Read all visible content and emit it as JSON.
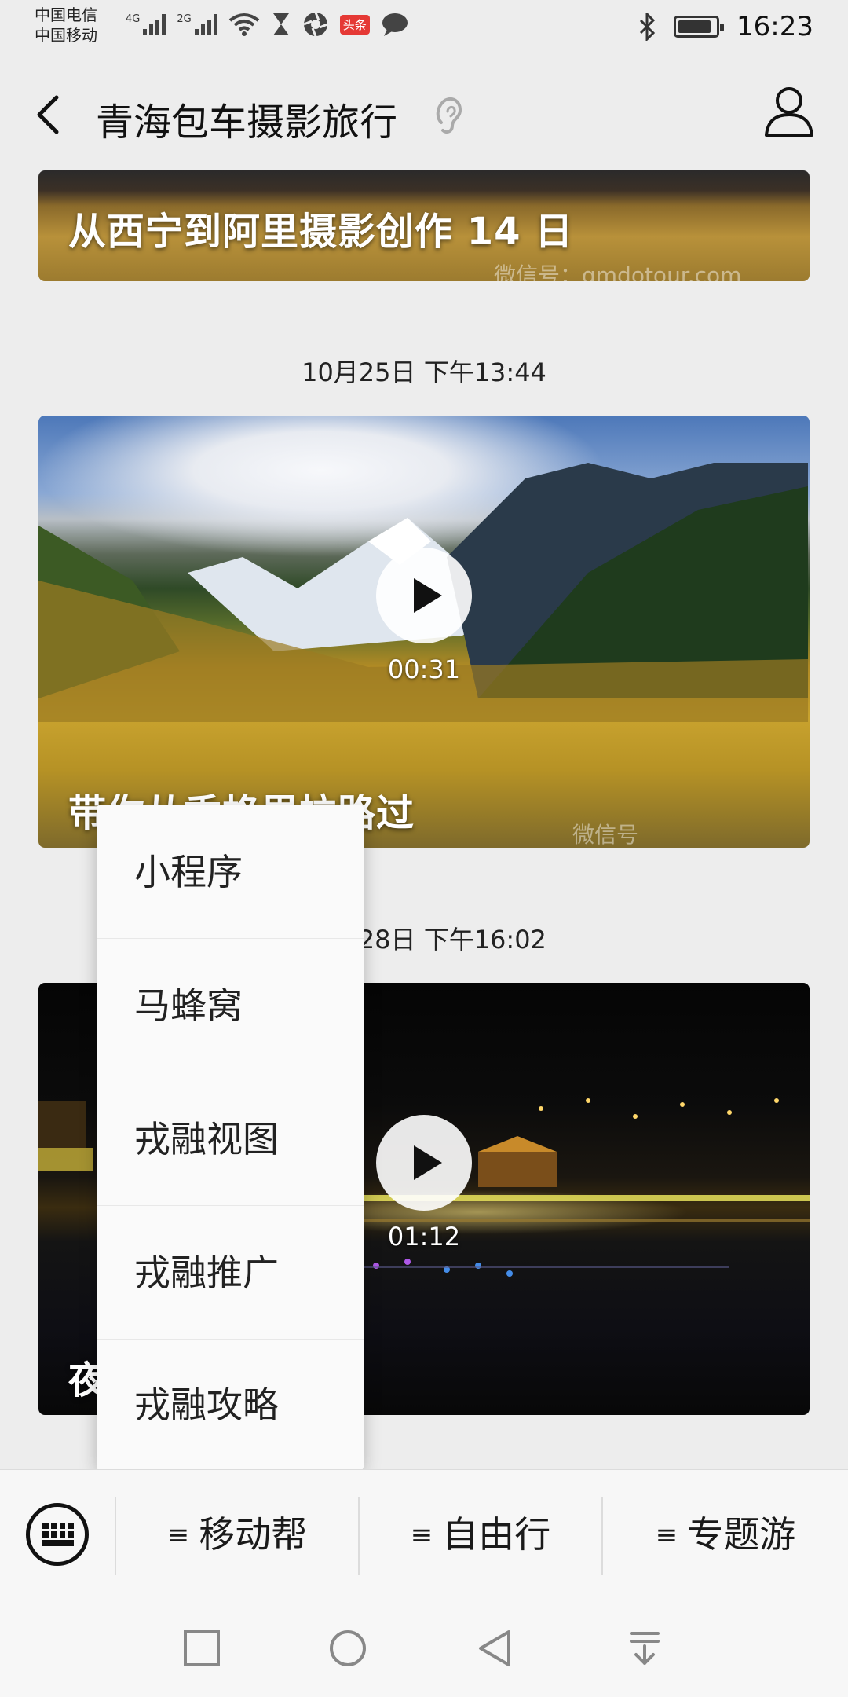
{
  "status_bar": {
    "carrier_1": "中国电信",
    "carrier_2": "中国移动",
    "net_1": "4G",
    "net_2": "2G",
    "badge": "头条",
    "time": "16:23",
    "battery_level": 0.9
  },
  "header": {
    "title": "青海包车摄影旅行"
  },
  "feed": {
    "card1": {
      "caption": "从西宁到阿里摄影创作 14 日",
      "watermark": "微信号：qmdotour.com"
    },
    "timestamp_1": "10月25日 下午13:44",
    "card2": {
      "duration": "00:31",
      "caption": "带你从香格里拉路过",
      "watermark": "微信号"
    },
    "timestamp_2": "10月28日 下午16:02",
    "card3": {
      "duration": "01:12",
      "caption": "夜"
    }
  },
  "popup_menu": {
    "items": [
      "小程序",
      "马蜂窝",
      "戎融视图",
      "戎融推广",
      "戎融攻略"
    ]
  },
  "menu_bar": {
    "tabs": [
      {
        "glyph": "≡",
        "label": "移动帮"
      },
      {
        "glyph": "≡",
        "label": "自由行"
      },
      {
        "glyph": "≡",
        "label": "专题游"
      }
    ]
  },
  "icons": {
    "back": "chevron-left-icon",
    "listen": "ear-icon",
    "profile": "person-icon",
    "keyboard": "keyboard-icon",
    "nav": [
      "square-icon",
      "circle-icon",
      "triangle-back-icon",
      "download-arrow-icon"
    ]
  }
}
